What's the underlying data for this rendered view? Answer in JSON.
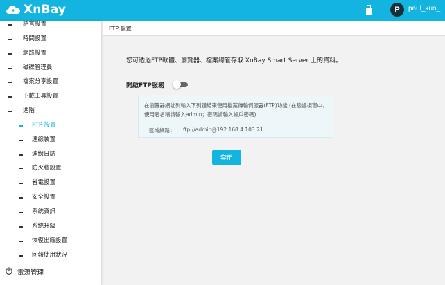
{
  "app": {
    "name": "XnBay",
    "accent": "#13b5e0"
  },
  "header": {
    "user_initial": "P",
    "username": "paul_kuo_"
  },
  "sidebar": {
    "items": [
      {
        "label": "語言設置",
        "level": 1
      },
      {
        "label": "時間設置",
        "level": 1
      },
      {
        "label": "網路設置",
        "level": 1
      },
      {
        "label": "磁碟管理員",
        "level": 1
      },
      {
        "label": "檔案分享設置",
        "level": 1
      },
      {
        "label": "下載工具設置",
        "level": 1
      },
      {
        "label": "進階",
        "level": 1
      },
      {
        "label": "FTP 設置",
        "level": 2,
        "active": true
      },
      {
        "label": "連線裝置",
        "level": 2
      },
      {
        "label": "連線日誌",
        "level": 2
      },
      {
        "label": "防火牆設置",
        "level": 2
      },
      {
        "label": "省電設置",
        "level": 2
      },
      {
        "label": "安全設置",
        "level": 2
      },
      {
        "label": "系統資訊",
        "level": 2
      },
      {
        "label": "系統升級",
        "level": 2
      },
      {
        "label": "恢復出廠設置",
        "level": 2
      },
      {
        "label": "回報使用狀況",
        "level": 2
      }
    ],
    "power_label": "電源管理"
  },
  "main": {
    "title": "FTP 設置",
    "intro": "您可透過FTP軟體、瀏覽器、檔案總管存取 XnBay Smart Server 上的資料。",
    "ftp_service_label": "開啟FTP服務",
    "ftp_service_enabled": false,
    "info_text": "在瀏覽器網址列輸入下列鏈結來使用檔案傳輸伺服器(FTP)功能 (在驗證視窗中，使用者名稱請輸入admin；密碼請輸入帳戶密碼)",
    "address_label": "區域網路：",
    "address_value": "ftp://admin@192.168.4.103:21",
    "apply_label": "套用"
  }
}
